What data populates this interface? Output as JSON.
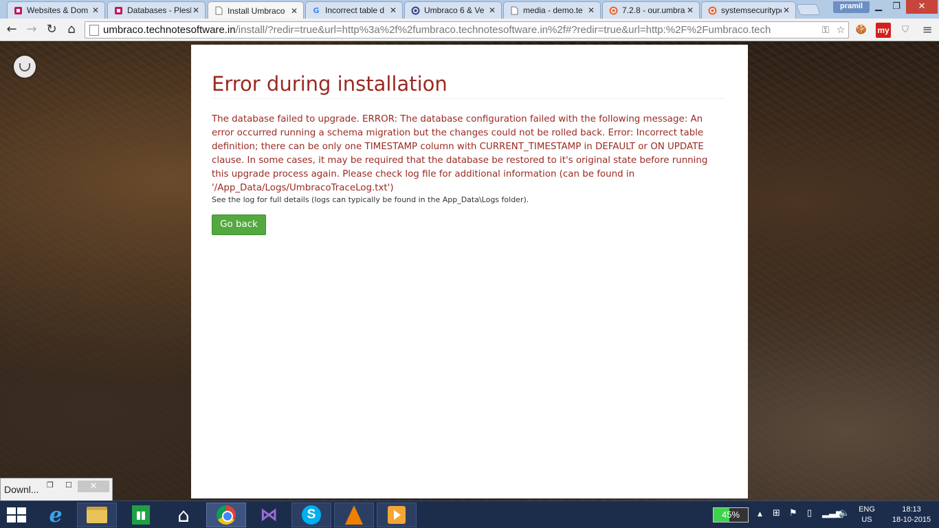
{
  "browser": {
    "tabs": [
      {
        "title": "Websites & Dom",
        "icon": "plesk-icon",
        "active": false
      },
      {
        "title": "Databases - Plesk",
        "icon": "plesk-icon",
        "active": false
      },
      {
        "title": "Install Umbraco",
        "icon": "page-icon",
        "active": true
      },
      {
        "title": "Incorrect table d",
        "icon": "google-icon",
        "active": false
      },
      {
        "title": "Umbraco 6 & Ve",
        "icon": "umbraco-icon",
        "active": false
      },
      {
        "title": "media - demo.te",
        "icon": "page-icon",
        "active": false
      },
      {
        "title": "7.2.8 - our.umbra",
        "icon": "our-umbraco-icon",
        "active": false
      },
      {
        "title": "systemsecuritype",
        "icon": "our-umbraco-icon",
        "active": false
      }
    ],
    "user": "pramil",
    "address": {
      "host": "umbraco.technotesoftware.in",
      "path": "/install/?redir=true&url=http%3a%2f%2fumbraco.technotesoftware.in%2f#?redir=true&url=http:%2F%2Fumbraco.tech"
    },
    "extensions": {
      "my_label": "my"
    }
  },
  "page": {
    "heading": "Error during installation",
    "error_message": "The database failed to upgrade. ERROR: The database configuration failed with the following message: An error occurred running a schema migration but the changes could not be rolled back. Error: Incorrect table definition; there can be only one TIMESTAMP column with CURRENT_TIMESTAMP in DEFAULT or ON UPDATE clause. In some cases, it may be required that the database be restored to it's original state before running this upgrade process again. Please check log file for additional information (can be found in '/App_Data/Logs/UmbracoTraceLog.txt')",
    "log_hint": "See the log for full details (logs can typically be found in the App_Data\\Logs folder).",
    "go_back_label": "Go back"
  },
  "download_shelf": {
    "label": "Downl..."
  },
  "taskbar": {
    "battery_percent": 45,
    "battery_label": "45%",
    "language": "ENG",
    "region": "US",
    "time": "18:13",
    "date": "18-10-2015"
  },
  "colors": {
    "error_text": "#9a2a22",
    "button_green": "#53a93f",
    "taskbar": "#1c2d4c"
  }
}
